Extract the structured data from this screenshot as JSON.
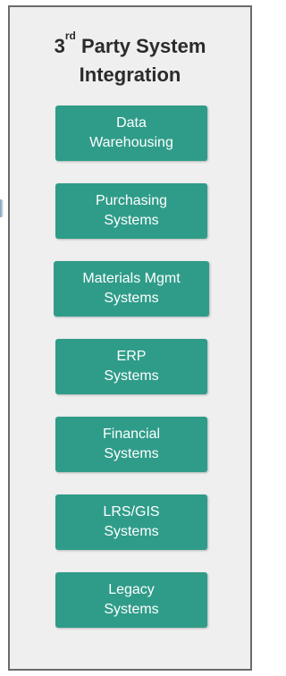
{
  "panel": {
    "title_sup_prefix": "3",
    "title_sup": "rd",
    "title_line1_rest": " Party System",
    "title_line2": "Integration",
    "accent_color": "#2f9c89",
    "border_color": "#6b6b6b",
    "background_color": "#efefef"
  },
  "systems": [
    {
      "label": "Data\nWarehousing"
    },
    {
      "label": "Purchasing\nSystems"
    },
    {
      "label": "Materials Mgmt\nSystems"
    },
    {
      "label": "ERP\nSystems"
    },
    {
      "label": "Financial\nSystems"
    },
    {
      "label": "LRS/GIS\nSystems"
    },
    {
      "label": "Legacy\nSystems"
    }
  ]
}
